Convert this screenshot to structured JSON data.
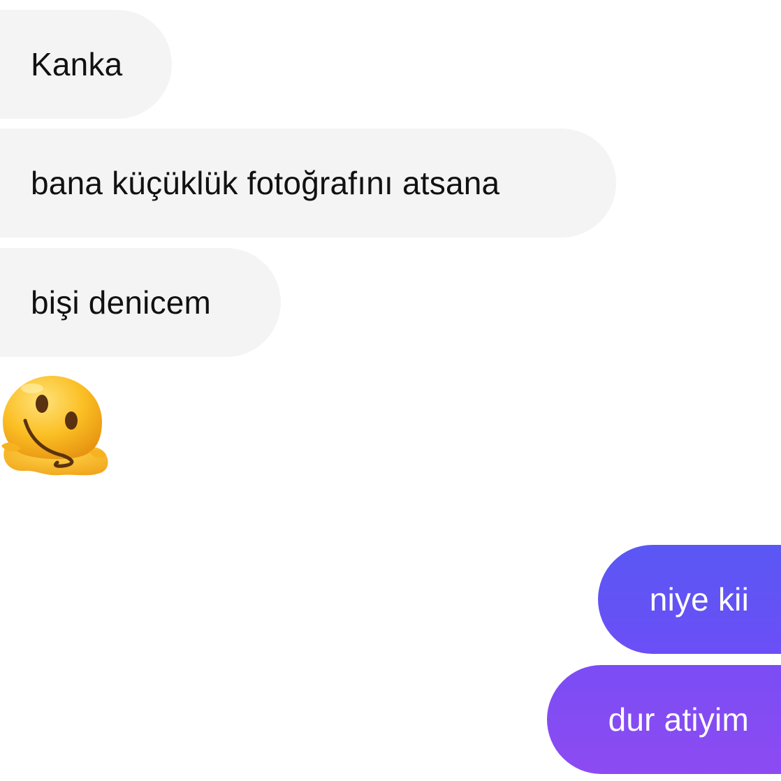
{
  "conversation": {
    "incoming": [
      {
        "text": "Kanka"
      },
      {
        "text": "bana küçüklük fotoğrafını atsana"
      },
      {
        "text": "bişi denicem"
      }
    ],
    "sticker": {
      "icon": "melting-face-emoji"
    },
    "outgoing": [
      {
        "text": "niye kii"
      },
      {
        "text": "dur atiyim"
      }
    ]
  },
  "colors": {
    "incoming_bubble": "#f4f4f4",
    "outgoing_bubble_top": "#5a57f4",
    "outgoing_bubble_bottom": "#8d4bf2",
    "emoji_yellow": "#fbbf24"
  }
}
